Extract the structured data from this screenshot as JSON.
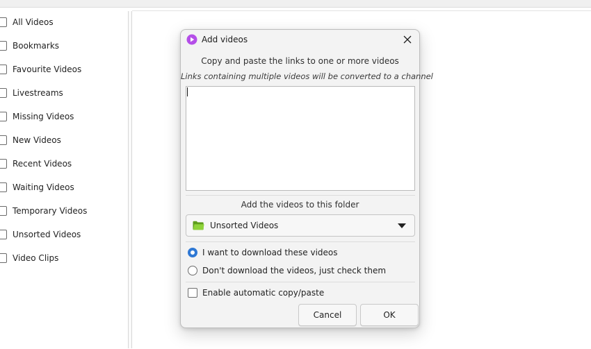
{
  "sidebar": {
    "items": [
      {
        "label": "All Videos"
      },
      {
        "label": "Bookmarks"
      },
      {
        "label": "Favourite Videos"
      },
      {
        "label": "Livestreams"
      },
      {
        "label": "Missing Videos"
      },
      {
        "label": "New Videos"
      },
      {
        "label": "Recent Videos"
      },
      {
        "label": "Waiting Videos"
      },
      {
        "label": "Temporary Videos"
      },
      {
        "label": "Unsorted Videos"
      },
      {
        "label": "Video Clips"
      }
    ]
  },
  "dialog": {
    "title": "Add videos",
    "title_icon": "play-circle-icon",
    "subtitle": "Copy and paste the links to one or more videos",
    "hint": "Links containing multiple videos will be converted to a channel",
    "links_value": "",
    "folder_label": "Add the videos to this folder",
    "folder_icon": "folder-icon",
    "folder_value": "Unsorted Videos",
    "options": {
      "download_label": "I want to download these videos",
      "check_only_label": "Don't download the videos, just check them",
      "selected": "download"
    },
    "auto_copy_label": "Enable automatic copy/paste",
    "auto_copy_checked": false,
    "cancel_label": "Cancel",
    "ok_label": "OK"
  },
  "colors": {
    "accent": "#2f78d4",
    "title_icon": "#b44ee8",
    "folder": "#7cc22a"
  }
}
